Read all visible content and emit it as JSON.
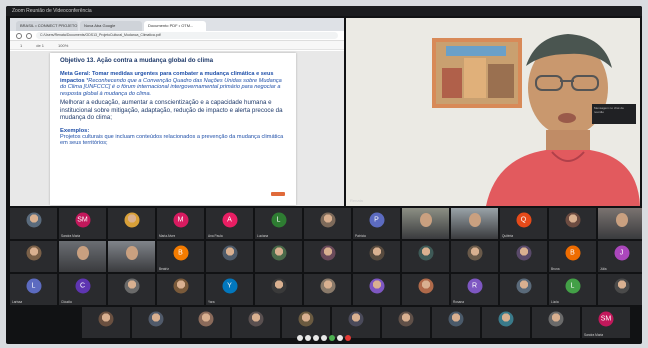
{
  "window": {
    "title": "Zoom Reunião de Videoconferência"
  },
  "browser": {
    "tabs": [
      {
        "label": "BRASIL • CONNECT PROJETO AG..."
      },
      {
        "label": "Nova Aba Google"
      },
      {
        "label": "Documento PDF • OTM..."
      }
    ],
    "url": "C:/Users/Renata/Documents/ODS13_ProjetoCultural_Mudanca_Climatica.pdf",
    "pdf_toolbar": {
      "page": "1",
      "of": "de 1",
      "zoom": "100%"
    }
  },
  "document": {
    "objective": "Objetivo 13. Ação contra a mudança global do clima",
    "meta_label": "Meta Geral:",
    "meta_bold": "Tomar medidas urgentes para combater a mudança climática e seus impactos",
    "meta_italic": "*Reconhecendo que a Convenção Quadro das Nações Unidas sobre Mudança do Clima [UNFCCC] é o fórum internacional intergovernamental primário para negociar a resposta global à mudança do clima.",
    "body": "Melhorar a educação, aumentar a conscientização e a capacidade humana e institucional sobre mitigação, adaptação, redução de impacto e alerta precoce da mudança do clima;",
    "examples_heading": "Exemplos:",
    "examples_text": "Projetos culturais que incluam conteúdos relacionados a prevenção da mudança climática em seus territórios;"
  },
  "speaker": {
    "name": "Renata"
  },
  "participants": {
    "row1": [
      {
        "name": "",
        "initials": "",
        "kind": "photo",
        "color": "#5a6b7d"
      },
      {
        "name": "Sandra Maria",
        "initials": "SM",
        "kind": "avatar",
        "color": "#c2185b"
      },
      {
        "name": "",
        "initials": "",
        "kind": "photo",
        "color": "#d8a038"
      },
      {
        "name": "Maria Alves",
        "initials": "M",
        "kind": "avatar",
        "color": "#d81b60"
      },
      {
        "name": "Ana Paula",
        "initials": "A",
        "kind": "avatar",
        "color": "#e91e63"
      },
      {
        "name": "Luciana",
        "initials": "L",
        "kind": "avatar",
        "color": "#2e7d32"
      },
      {
        "name": "",
        "initials": "",
        "kind": "photo",
        "color": "#7d6a5a"
      },
      {
        "name": "Patrícia",
        "initials": "P",
        "kind": "avatar",
        "color": "#5c6bc0"
      },
      {
        "name": "",
        "initials": "",
        "kind": "cam",
        "color": "#8c8f84"
      },
      {
        "name": "",
        "initials": "",
        "kind": "cam",
        "color": "#9aa3a8"
      },
      {
        "name": "Quitéria",
        "initials": "Q",
        "kind": "avatar",
        "color": "#e64a19"
      },
      {
        "name": "",
        "initials": "",
        "kind": "photo",
        "color": "#6d4c41"
      },
      {
        "name": "",
        "initials": "",
        "kind": "cam",
        "color": "#7a7370"
      }
    ],
    "row2": [
      {
        "name": "",
        "initials": "",
        "kind": "photo",
        "color": "#7a6048"
      },
      {
        "name": "",
        "initials": "",
        "kind": "cam",
        "color": "#6b6e73"
      },
      {
        "name": "",
        "initials": "",
        "kind": "cam",
        "color": "#80848a"
      },
      {
        "name": "Beatriz",
        "initials": "B",
        "kind": "avatar",
        "color": "#f57c00"
      },
      {
        "name": "",
        "initials": "",
        "kind": "photo",
        "color": "#4e5b6a"
      },
      {
        "name": "",
        "initials": "",
        "kind": "photo",
        "color": "#4a6a4a"
      },
      {
        "name": "",
        "initials": "",
        "kind": "photo",
        "color": "#6a4a5a"
      },
      {
        "name": "",
        "initials": "",
        "kind": "photo",
        "color": "#574a3e"
      },
      {
        "name": "",
        "initials": "",
        "kind": "photo",
        "color": "#3e5a57"
      },
      {
        "name": "",
        "initials": "",
        "kind": "photo",
        "color": "#6a5a4a"
      },
      {
        "name": "",
        "initials": "",
        "kind": "photo",
        "color": "#5a4a6a"
      },
      {
        "name": "Bruna",
        "initials": "B",
        "kind": "avatar",
        "color": "#ef6c00"
      },
      {
        "name": "Júlia",
        "initials": "J",
        "kind": "avatar",
        "color": "#ab47bc"
      }
    ],
    "row3": [
      {
        "name": "Larissa",
        "initials": "L",
        "kind": "avatar",
        "color": "#5c6bc0"
      },
      {
        "name": "Cláudia",
        "initials": "C",
        "kind": "avatar",
        "color": "#5e35b1"
      },
      {
        "name": "",
        "initials": "",
        "kind": "photo",
        "color": "#6a6a6a"
      },
      {
        "name": "",
        "initials": "",
        "kind": "photo",
        "color": "#7a5a3a"
      },
      {
        "name": "Yara",
        "initials": "Y",
        "kind": "avatar",
        "color": "#0277bd"
      },
      {
        "name": "",
        "initials": "",
        "kind": "photo",
        "color": "#3a3a3a"
      },
      {
        "name": "",
        "initials": "",
        "kind": "photo",
        "color": "#8a7a6a"
      },
      {
        "name": "",
        "initials": "",
        "kind": "photo",
        "color": "#7e57c2"
      },
      {
        "name": "",
        "initials": "",
        "kind": "photo",
        "color": "#b06a4a"
      },
      {
        "name": "Rosana",
        "initials": "R",
        "kind": "avatar",
        "color": "#7e57c2"
      },
      {
        "name": "",
        "initials": "",
        "kind": "photo",
        "color": "#5a6a7a"
      },
      {
        "name": "Lúcia",
        "initials": "L",
        "kind": "avatar",
        "color": "#43a047"
      },
      {
        "name": "",
        "initials": "",
        "kind": "photo",
        "color": "#4a4a4a"
      }
    ],
    "row4": [
      {
        "name": "",
        "initials": "",
        "kind": "photo",
        "color": "#6a5040"
      },
      {
        "name": "",
        "initials": "",
        "kind": "photo",
        "color": "#505a6a"
      },
      {
        "name": "",
        "initials": "",
        "kind": "photo",
        "color": "#8a6a5a"
      },
      {
        "name": "",
        "initials": "",
        "kind": "photo",
        "color": "#5a5050"
      },
      {
        "name": "",
        "initials": "",
        "kind": "photo",
        "color": "#6a5a40"
      },
      {
        "name": "",
        "initials": "",
        "kind": "photo",
        "color": "#4a4a5a"
      },
      {
        "name": "",
        "initials": "",
        "kind": "photo",
        "color": "#605048"
      },
      {
        "name": "",
        "initials": "",
        "kind": "photo",
        "color": "#4a5a6a"
      },
      {
        "name": "",
        "initials": "",
        "kind": "photo",
        "color": "#3a7a8a"
      },
      {
        "name": "",
        "initials": "",
        "kind": "photo",
        "color": "#6a6a6a"
      },
      {
        "name": "Sandra Maria",
        "initials": "SM",
        "kind": "avatar",
        "color": "#c2185b"
      }
    ]
  },
  "chat": {
    "text": "Mensagem no chat da reunião"
  }
}
